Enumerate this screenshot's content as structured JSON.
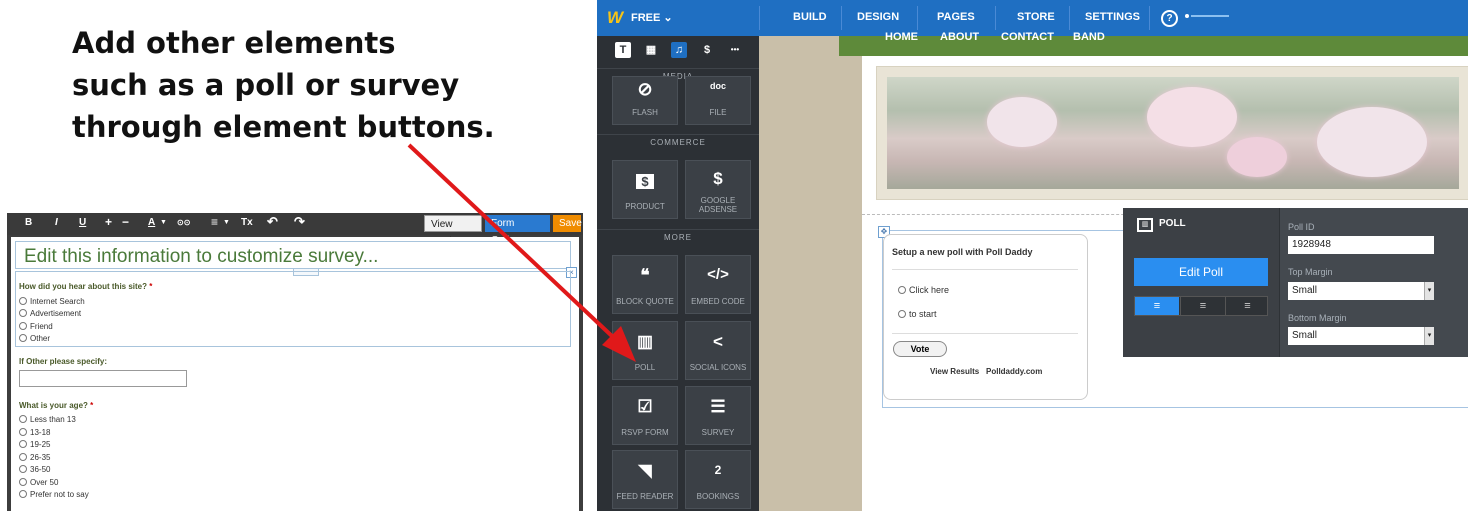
{
  "caption": {
    "lines": [
      "Add other elements",
      "such as a poll or survey",
      "through element buttons."
    ]
  },
  "survey_editor": {
    "toolbar": {
      "bold": "B",
      "italic": "I",
      "underline": "U",
      "plus": "+",
      "minus": "−",
      "font_color": "A",
      "link": "⊙⊙",
      "align": "≡",
      "clear_format": "Tx",
      "undo": "↶",
      "redo": "↷",
      "view_entries": "View Entries",
      "form_options": "Form Options",
      "save": "Save"
    },
    "title": "Edit this information to customize survey...",
    "q1": {
      "label": "How did you hear about this site?",
      "required": "*",
      "options": [
        "Internet Search",
        "Advertisement",
        "Friend",
        "Other"
      ]
    },
    "q2": {
      "label": "If Other please specify:"
    },
    "q3": {
      "label": "What is your age?",
      "required": "*",
      "options": [
        "Less than 13",
        "13-18",
        "19-25",
        "26-35",
        "36-50",
        "Over 50",
        "Prefer not to say"
      ]
    }
  },
  "weebly": {
    "plan": "FREE",
    "logo": "W",
    "tabs": [
      "BUILD",
      "DESIGN",
      "PAGES",
      "STORE",
      "SETTINGS"
    ],
    "help_icon": "?",
    "sidebar": {
      "tools": [
        "T",
        "▦",
        "♫",
        "$",
        "•••"
      ],
      "sections": {
        "media": "MEDIA",
        "commerce": "COMMERCE",
        "more": "MORE"
      },
      "media_items": [
        {
          "label": "FLASH",
          "icon": "flash-icon",
          "glyph": "⊘"
        },
        {
          "label": "FILE",
          "icon": "file-icon",
          "glyph": "doc"
        }
      ],
      "commerce_items": [
        {
          "label": "PRODUCT",
          "icon": "dollar-icon",
          "glyph": "$"
        },
        {
          "label": "GOOGLE ADSENSE",
          "icon": "adsense-icon",
          "glyph": "$"
        }
      ],
      "more_items": [
        {
          "label": "BLOCK QUOTE",
          "icon": "quote-icon",
          "glyph": "❝"
        },
        {
          "label": "EMBED CODE",
          "icon": "code-icon",
          "glyph": "</>"
        },
        {
          "label": "POLL",
          "icon": "poll-icon",
          "glyph": "▥"
        },
        {
          "label": "SOCIAL ICONS",
          "icon": "share-icon",
          "glyph": "<"
        },
        {
          "label": "RSVP FORM",
          "icon": "rsvp-icon",
          "glyph": "☑"
        },
        {
          "label": "SURVEY",
          "icon": "survey-icon",
          "glyph": "☰"
        },
        {
          "label": "FEED READER",
          "icon": "rss-icon",
          "glyph": "◥"
        },
        {
          "label": "BOOKINGS",
          "icon": "calendar-icon",
          "glyph": "2"
        }
      ]
    },
    "nav": [
      "HOME",
      "ABOUT",
      "CONTACT",
      "BAND"
    ],
    "poll_widget": {
      "title": "Setup a new poll with Poll Daddy",
      "options": [
        "Click here",
        "to start"
      ],
      "vote": "Vote",
      "view_results": "View Results",
      "brand": "Polldaddy.com"
    },
    "poll_panel": {
      "title": "POLL",
      "edit_button": "Edit Poll",
      "poll_id_label": "Poll ID",
      "poll_id_value": "1928948",
      "top_margin_label": "Top Margin",
      "top_margin_value": "Small",
      "bottom_margin_label": "Bottom Margin",
      "bottom_margin_value": "Small"
    }
  },
  "colors": {
    "weebly_blue": "#1f6fc2",
    "arrow_red": "#e0191a",
    "nav_green": "#5e8a3a",
    "edit_blue": "#2a8ef0",
    "save_orange": "#f08c00"
  }
}
